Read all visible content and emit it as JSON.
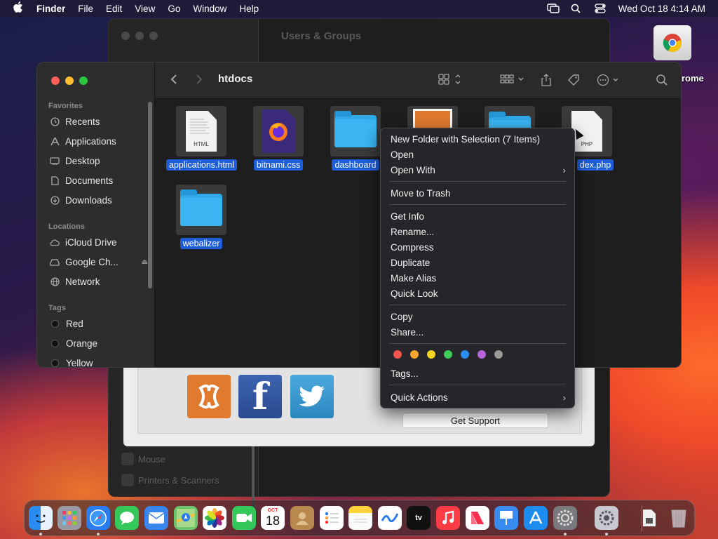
{
  "menubar": {
    "app_name": "Finder",
    "menus": [
      "File",
      "Edit",
      "View",
      "Go",
      "Window",
      "Help"
    ],
    "clock": "Wed Oct 18  4:14 AM"
  },
  "background_window": {
    "title": "Users & Groups",
    "sidebar_items": [
      "Mouse",
      "Printers & Scanners"
    ],
    "support_button": "Get Support"
  },
  "desktop": {
    "chrome_label": "rome"
  },
  "finder": {
    "title": "htdocs",
    "sidebar": {
      "favorites_header": "Favorites",
      "favorites": [
        {
          "label": "Recents",
          "icon": "clock-icon"
        },
        {
          "label": "Applications",
          "icon": "applications-icon"
        },
        {
          "label": "Desktop",
          "icon": "desktop-icon"
        },
        {
          "label": "Documents",
          "icon": "document-icon"
        },
        {
          "label": "Downloads",
          "icon": "download-icon"
        }
      ],
      "locations_header": "Locations",
      "locations": [
        {
          "label": "iCloud Drive",
          "icon": "cloud-icon"
        },
        {
          "label": "Google Ch...",
          "icon": "disk-icon"
        },
        {
          "label": "Network",
          "icon": "globe-icon"
        }
      ],
      "tags_header": "Tags",
      "tags": [
        "Red",
        "Orange",
        "Yellow"
      ]
    },
    "files": [
      {
        "name": "applications.html",
        "kind": "html",
        "badge": "HTML"
      },
      {
        "name": "bitnami.css",
        "kind": "css"
      },
      {
        "name": "dashboard",
        "kind": "folder"
      },
      {
        "name": "",
        "kind": "xampp"
      },
      {
        "name": "",
        "kind": "folder"
      },
      {
        "name": "dex.php",
        "kind": "php",
        "badge": "PHP"
      },
      {
        "name": "webalizer",
        "kind": "folder"
      }
    ]
  },
  "context_menu": {
    "items": [
      "New Folder with Selection (7 Items)",
      "Open",
      "Open With",
      "Move to Trash",
      "Get Info",
      "Rename...",
      "Compress",
      "Duplicate",
      "Make Alias",
      "Quick Look",
      "Copy",
      "Share...",
      "Tags...",
      "Quick Actions"
    ],
    "tag_colors": [
      "#f2544d",
      "#f8a530",
      "#f6d51f",
      "#3dcc58",
      "#2c8df2",
      "#b865dc",
      "#9a9a9a"
    ]
  },
  "dock": {
    "calendar_month": "OCT",
    "calendar_day": "18"
  }
}
